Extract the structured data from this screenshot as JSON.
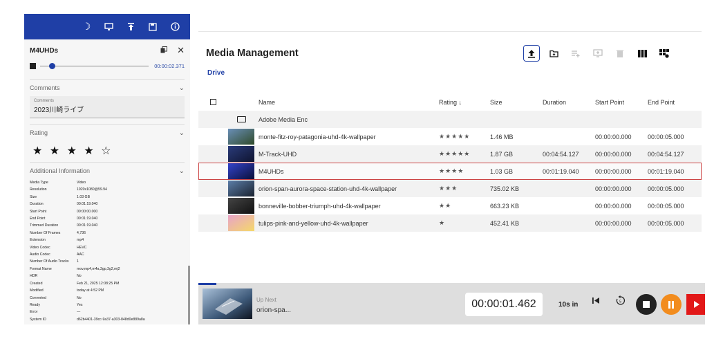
{
  "left_panel": {
    "title": "M4UHDs",
    "player_time": "00:00:02.371",
    "player_progress_fraction": 0.08,
    "comments_section": "Comments",
    "comment_label": "Comments",
    "comment_value": "2023川崎ライブ",
    "rating_section": "Rating",
    "rating_stars": "★ ★ ★ ★ ☆",
    "rating_value": 4,
    "additional_section": "Additional Information",
    "info": [
      {
        "key": "Media Type",
        "value": "Video"
      },
      {
        "key": "Resolution",
        "value": "1920x1080@59.94"
      },
      {
        "key": "Size",
        "value": "1.03 GB"
      },
      {
        "key": "Duration",
        "value": "00:01:19.040"
      },
      {
        "key": "Start Point",
        "value": "00:00:00.000"
      },
      {
        "key": "End Point",
        "value": "00:01:19.040"
      },
      {
        "key": "Trimmed Duration",
        "value": "00:01:19.040"
      },
      {
        "key": "Number Of Frames",
        "value": "4,736"
      },
      {
        "key": "Extension",
        "value": "mp4"
      },
      {
        "key": "Video Codec",
        "value": "HEVC"
      },
      {
        "key": "Audio Codec",
        "value": "AAC"
      },
      {
        "key": "Number Of Audio Tracks",
        "value": "1"
      },
      {
        "key": "Format Name",
        "value": "mov,mp4,m4a,3gp,3g2,mj2"
      },
      {
        "key": "HDR",
        "value": "No"
      },
      {
        "key": "Created",
        "value": "Feb 21, 2025 12:08:25 PM"
      },
      {
        "key": "Modified",
        "value": "today at 4:52 PM"
      },
      {
        "key": "Converted",
        "value": "No"
      },
      {
        "key": "Ready",
        "value": "Yes"
      },
      {
        "key": "Error",
        "value": "—"
      },
      {
        "key": "System ID",
        "value": "d62b4401-39cc-9a37-a303-848d0e889a8a"
      }
    ]
  },
  "main": {
    "title": "Media Management",
    "breadcrumb": "Drive",
    "columns": {
      "name": "Name",
      "rating": "Rating ↓",
      "size": "Size",
      "duration": "Duration",
      "start": "Start Point",
      "end": "End Point"
    },
    "rows": [
      {
        "name": "Adobe Media Enc",
        "rating": "",
        "size": "",
        "duration": "",
        "start": "",
        "end": "",
        "folder": true
      },
      {
        "name": "monte-fitz-roy-patagonia-uhd-4k-wallpaper",
        "rating": "★★★★★",
        "size": "1.46 MB",
        "duration": "",
        "start": "00:00:00.000",
        "end": "00:00:05.000",
        "colors": [
          "#6a8fb8",
          "#2f4a2a"
        ]
      },
      {
        "name": "M-Track-UHD",
        "rating": "★★★★★",
        "size": "1.87 GB",
        "duration": "00:04:54.127",
        "start": "00:00:00.000",
        "end": "00:04:54.127",
        "colors": [
          "#2a3b7a",
          "#0f1430"
        ]
      },
      {
        "name": "M4UHDs",
        "rating": "★★★★",
        "size": "1.03 GB",
        "duration": "00:01:19.040",
        "start": "00:00:00.000",
        "end": "00:01:19.040",
        "colors": [
          "#3344cc",
          "#0a0f3a"
        ]
      },
      {
        "name": "orion-span-aurora-space-station-uhd-4k-wallpaper",
        "rating": "★★★",
        "size": "735.02 KB",
        "duration": "",
        "start": "00:00:00.000",
        "end": "00:00:05.000",
        "colors": [
          "#5c7ea8",
          "#1a2230"
        ]
      },
      {
        "name": "bonneville-bobber-triumph-uhd-4k-wallpaper",
        "rating": "★★",
        "size": "663.23 KB",
        "duration": "",
        "start": "00:00:00.000",
        "end": "00:00:05.000",
        "colors": [
          "#444",
          "#111"
        ]
      },
      {
        "name": "tulips-pink-and-yellow-uhd-4k-wallpaper",
        "rating": "★",
        "size": "452.41 KB",
        "duration": "",
        "start": "00:00:00.000",
        "end": "00:00:05.000",
        "colors": [
          "#e8a3c8",
          "#f4d86a"
        ]
      }
    ],
    "selected_row": 3
  },
  "bottom_bar": {
    "up_next_label": "Up Next",
    "up_next_name": "orion-spa...",
    "time": "00:00:01.462",
    "skip_label": "10s in",
    "progress_fraction": 0.035
  },
  "icons": {
    "topbar": [
      "moon-icon",
      "monitor-icon",
      "upload-arrow-icon",
      "save-icon",
      "info-icon"
    ],
    "toolbar": [
      "upload-icon",
      "new-folder-icon",
      "add-to-list-icon",
      "add-to-screen-icon",
      "delete-icon",
      "columns-icon",
      "grid-settings-icon"
    ]
  },
  "colors": {
    "brand_blue": "#1f3fa6",
    "pause_orange": "#f28c1e",
    "record_red": "#e21818",
    "selected_outline": "#cc4444"
  }
}
